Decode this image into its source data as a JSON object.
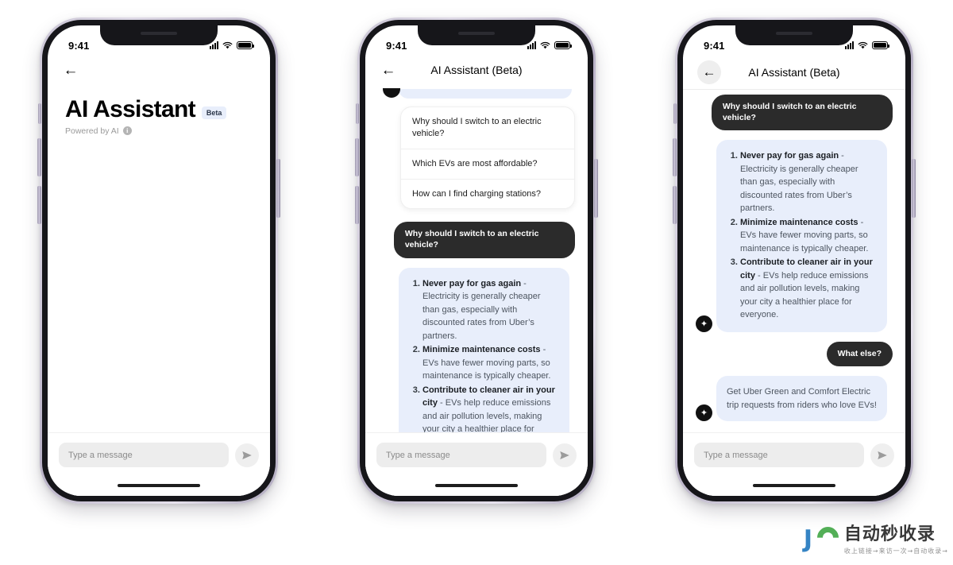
{
  "status_bar": {
    "time": "9:41",
    "signal": "signal-icon",
    "wifi": "wifi-icon",
    "battery": "battery-icon"
  },
  "composer": {
    "placeholder": "Type a message",
    "value": "",
    "send_icon": "send-icon"
  },
  "icons": {
    "back": "←",
    "sparkle": "✦",
    "info": "i"
  },
  "phones": [
    {
      "id": "phone-1",
      "nav": {
        "back_label": "←",
        "title": ""
      },
      "header": {
        "title": "AI Assistant",
        "badge": "Beta",
        "subtitle": "Powered by AI"
      },
      "messages": []
    },
    {
      "id": "phone-2",
      "nav": {
        "back_label": "←",
        "title": "AI Assistant (Beta)"
      },
      "suggestions": [
        "Why should I switch to an electric vehicle?",
        "Which EVs are most affordable?",
        "How can I find charging stations?"
      ],
      "messages": [
        {
          "role": "user",
          "text": "Why should I switch to an electric vehicle?"
        },
        {
          "role": "ai",
          "list": [
            {
              "bold": "Never pay for gas again",
              "rest": " - Electricity is generally cheaper than gas, especially with discounted rates from Uber’s partners."
            },
            {
              "bold": "Minimize maintenance costs",
              "rest": " - EVs have fewer moving parts, so maintenance is typically cheaper."
            },
            {
              "bold": "Contribute to cleaner air in your city",
              "rest": " - EVs help reduce emissions and air pollution levels, making your city a healthier place for everyone."
            }
          ]
        }
      ]
    },
    {
      "id": "phone-3",
      "nav": {
        "back_label": "←",
        "title": "AI Assistant (Beta)"
      },
      "messages": [
        {
          "role": "user",
          "text": "Why should I switch to an electric vehicle?"
        },
        {
          "role": "ai",
          "list": [
            {
              "bold": "Never pay for gas again",
              "rest": " - Electricity is generally cheaper than gas, especially with discounted rates from Uber’s partners."
            },
            {
              "bold": "Minimize maintenance costs",
              "rest": " - EVs have fewer moving parts, so maintenance is typically cheaper."
            },
            {
              "bold": "Contribute to cleaner air in your city",
              "rest": " - EVs help reduce emissions and air pollution levels, making your city a healthier place for everyone."
            }
          ]
        },
        {
          "role": "user",
          "text": "What else?"
        },
        {
          "role": "ai",
          "text": "Get Uber Green and Comfort Electric trip requests from riders who love EVs!"
        }
      ]
    }
  ],
  "watermark": {
    "logo_j": "J",
    "title": "自动秒收录",
    "subtitle": "收上链接→来访一次→自动收录→"
  },
  "colors": {
    "ai_bubble": "#e8eefb",
    "user_bubble": "#2b2b2b",
    "badge_bg": "#e8eefb",
    "input_bg": "#ededed"
  }
}
